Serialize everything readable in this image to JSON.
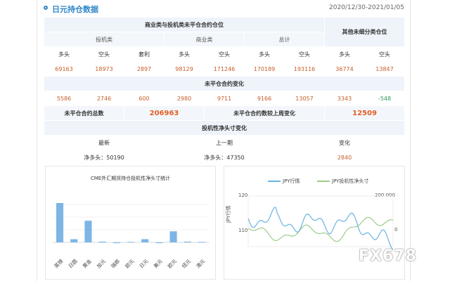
{
  "header": {
    "title": "日元持仓数据",
    "date_range": "2020/12/30-2021/01/05"
  },
  "table": {
    "group_noncommercial": "商业类与投机类未平仓合约仓位",
    "group_other": "其他未细分类仓位",
    "speculative": "投机类",
    "commercial": "商业类",
    "total": "总计",
    "long": "多头",
    "short": "空头",
    "spread": "套利",
    "row1": [
      "69163",
      "18973",
      "2897",
      "98129",
      "171246",
      "170189",
      "193116",
      "36774",
      "13847"
    ],
    "change_title": "未平仓合约变化",
    "row2": [
      "5586",
      "2746",
      "600",
      "2980",
      "9711",
      "9166",
      "13057",
      "3343",
      "-548"
    ],
    "oi_total_label": "未平仓合约总数",
    "oi_total_value": "206963",
    "oi_change_label": "未平仓合约数较上周变化",
    "oi_change_value": "12509",
    "net_title": "投机性净头寸变化",
    "latest": "最新",
    "prev_week": "上一期",
    "change": "变化",
    "latest_value": "净多头：50190",
    "prev_value": "净多头：47350",
    "change_value": "2840"
  },
  "left_chart": {
    "title": "CME外汇期货持仓投机性净头寸统计",
    "chart_data": {
      "type": "bar",
      "categories": [
        "英镑",
        "日圆",
        "黄金",
        "加元",
        "瑞郎",
        "欧元",
        "日元",
        "美元",
        "欧元",
        "纽元",
        "澳元"
      ],
      "values": [
        100,
        8,
        55,
        2,
        -2,
        1,
        8,
        -2,
        28,
        2,
        1
      ],
      "color": "#7cb5e6"
    }
  },
  "right_chart": {
    "legend": [
      "JPY行情",
      "JPY投机性净头寸"
    ],
    "left_ticks": [
      "120",
      "110"
    ],
    "right_ticks": [
      "200 000",
      "0"
    ],
    "ylabel": "JPY行情",
    "colors": {
      "jpy": "#6ab4e0",
      "net": "#9ccc8a"
    }
  },
  "watermark": "FX678"
}
